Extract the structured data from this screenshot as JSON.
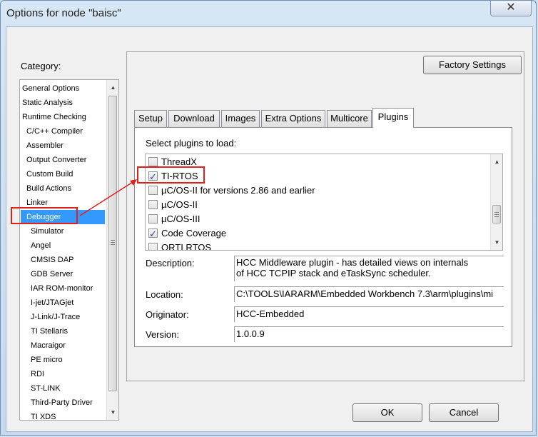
{
  "window": {
    "title": "Options for node \"baisc\"",
    "close_glyph": "✕"
  },
  "category": {
    "label": "Category:",
    "items": [
      {
        "label": "General Options",
        "level": 0
      },
      {
        "label": "Static Analysis",
        "level": 0
      },
      {
        "label": "Runtime Checking",
        "level": 0
      },
      {
        "label": "C/C++ Compiler",
        "level": 1
      },
      {
        "label": "Assembler",
        "level": 1
      },
      {
        "label": "Output Converter",
        "level": 1
      },
      {
        "label": "Custom Build",
        "level": 1
      },
      {
        "label": "Build Actions",
        "level": 1
      },
      {
        "label": "Linker",
        "level": 1
      },
      {
        "label": "Debugger",
        "level": 1,
        "selected": true
      },
      {
        "label": "Simulator",
        "level": 2
      },
      {
        "label": "Angel",
        "level": 2
      },
      {
        "label": "CMSIS DAP",
        "level": 2
      },
      {
        "label": "GDB Server",
        "level": 2
      },
      {
        "label": "IAR ROM-monitor",
        "level": 2
      },
      {
        "label": "I-jet/JTAGjet",
        "level": 2
      },
      {
        "label": "J-Link/J-Trace",
        "level": 2
      },
      {
        "label": "TI Stellaris",
        "level": 2
      },
      {
        "label": "Macraigor",
        "level": 2
      },
      {
        "label": "PE micro",
        "level": 2
      },
      {
        "label": "RDI",
        "level": 2
      },
      {
        "label": "ST-LINK",
        "level": 2
      },
      {
        "label": "Third-Party Driver",
        "level": 2
      },
      {
        "label": "TI XDS",
        "level": 2
      }
    ]
  },
  "factory_settings_label": "Factory Settings",
  "tabs": [
    {
      "label": "Setup"
    },
    {
      "label": "Download"
    },
    {
      "label": "Images"
    },
    {
      "label": "Extra Options"
    },
    {
      "label": "Multicore"
    },
    {
      "label": "Plugins",
      "active": true
    }
  ],
  "plugins": {
    "select_label": "Select plugins to load:",
    "items": [
      {
        "label": "ThreadX",
        "checked": false
      },
      {
        "label": "TI-RTOS",
        "checked": true
      },
      {
        "label": "µC/OS-II for versions 2.86 and earlier",
        "checked": false
      },
      {
        "label": "µC/OS-II",
        "checked": false
      },
      {
        "label": "µC/OS-III",
        "checked": false
      },
      {
        "label": "Code Coverage",
        "checked": true
      },
      {
        "label": "ORTI RTOS",
        "checked": false
      }
    ]
  },
  "details": {
    "description_label": "Description:",
    "description_line1": "HCC Middleware plugin - has detailed views on internals",
    "description_line2": "of HCC TCPIP stack and eTaskSync scheduler.",
    "location_label": "Location:",
    "location_value": "C:\\TOOLS\\IARARM\\Embedded Workbench 7.3\\arm\\plugins\\mi",
    "originator_label": "Originator:",
    "originator_value": "HCC-Embedded",
    "version_label": "Version:",
    "version_value": "1.0.0.9"
  },
  "buttons": {
    "ok": "OK",
    "cancel": "Cancel"
  },
  "colors": {
    "selection": "#3399ff",
    "annotation_red": "#e0201a"
  }
}
